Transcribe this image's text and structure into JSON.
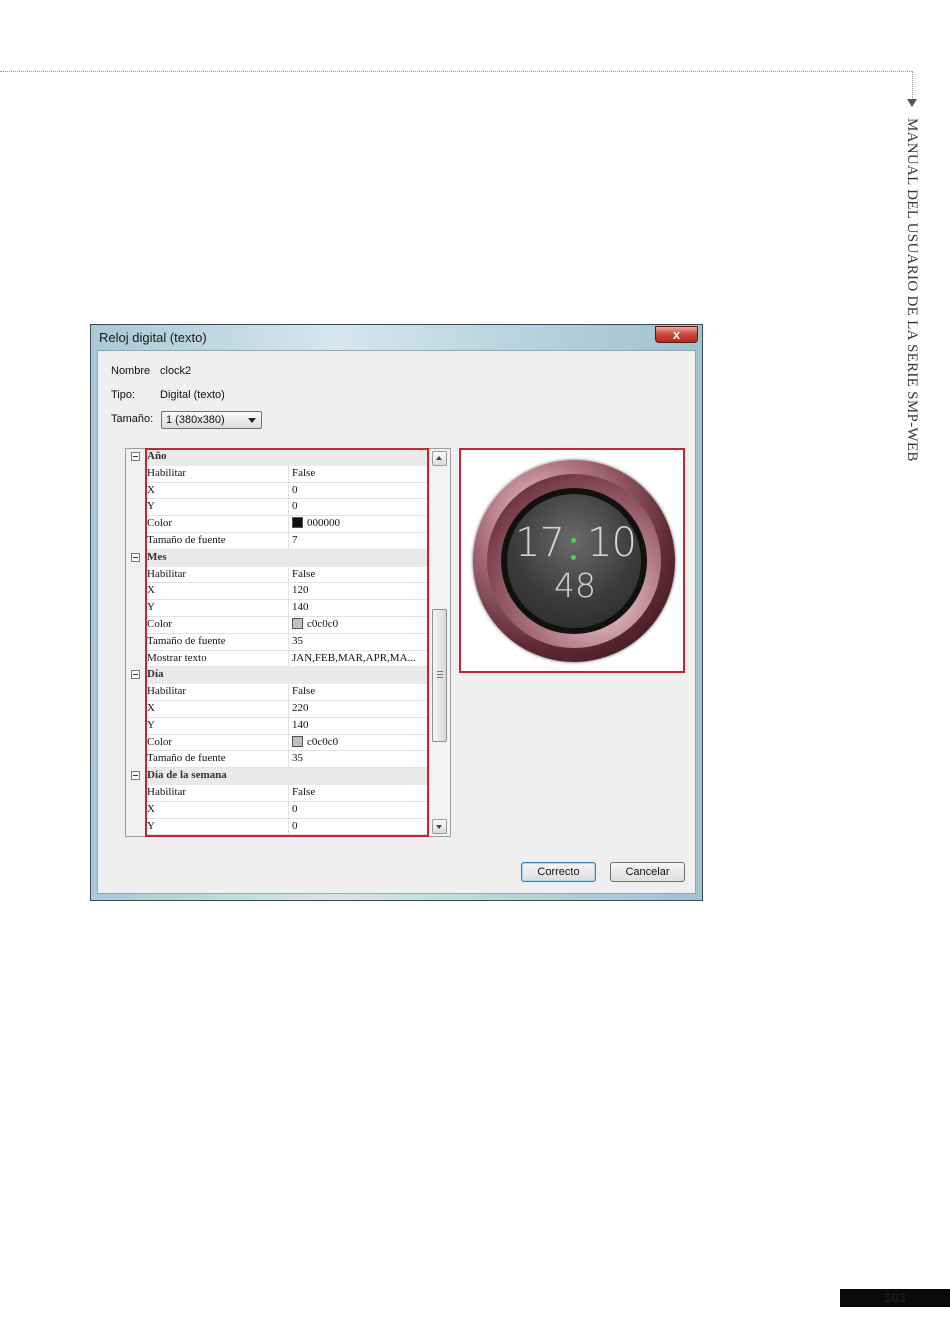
{
  "page": {
    "side_title": "MANUAL DEL USUARIO DE LA SERIE SMP-WEB",
    "page_number": "103"
  },
  "dialog": {
    "title": "Reloj digital (texto)",
    "close_glyph": "x",
    "nombre_label": "Nombre",
    "nombre_value": "clock2",
    "tipo_label": "Tipo:",
    "tipo_value": "Digital (texto)",
    "tamano_label": "Tamaño:",
    "tamano_value": "1   (380x380)",
    "ok_label": "Correcto",
    "cancel_label": "Cancelar"
  },
  "properties": {
    "ano": {
      "title": "Año",
      "rows": [
        {
          "k": "Habilitar",
          "v": "False"
        },
        {
          "k": "X",
          "v": "0"
        },
        {
          "k": "Y",
          "v": "0"
        },
        {
          "k": "Color",
          "v": "000000",
          "swatch": "#111111"
        },
        {
          "k": "Tamaño de fuente",
          "v": "7"
        }
      ]
    },
    "mes": {
      "title": "Mes",
      "rows": [
        {
          "k": "Habilitar",
          "v": "False"
        },
        {
          "k": "X",
          "v": "120"
        },
        {
          "k": "Y",
          "v": "140"
        },
        {
          "k": "Color",
          "v": "c0c0c0",
          "swatch": "#c0c0c0"
        },
        {
          "k": "Tamaño de fuente",
          "v": "35"
        },
        {
          "k": "Mostrar texto",
          "v": "JAN,FEB,MAR,APR,MA..."
        }
      ]
    },
    "dia": {
      "title": "Día",
      "rows": [
        {
          "k": "Habilitar",
          "v": "False"
        },
        {
          "k": "X",
          "v": "220"
        },
        {
          "k": "Y",
          "v": "140"
        },
        {
          "k": "Color",
          "v": "c0c0c0",
          "swatch": "#c0c0c0"
        },
        {
          "k": "Tamaño de fuente",
          "v": "35"
        }
      ]
    },
    "dia_semana": {
      "title": "Día de la semana",
      "rows": [
        {
          "k": "Habilitar",
          "v": "False"
        },
        {
          "k": "X",
          "v": "0"
        },
        {
          "k": "Y",
          "v": "0"
        }
      ]
    }
  },
  "preview": {
    "hours": "17",
    "minutes": "10",
    "seconds": "48",
    "colon_color": "#4bd34b",
    "highlight_color": "#c0282d"
  }
}
